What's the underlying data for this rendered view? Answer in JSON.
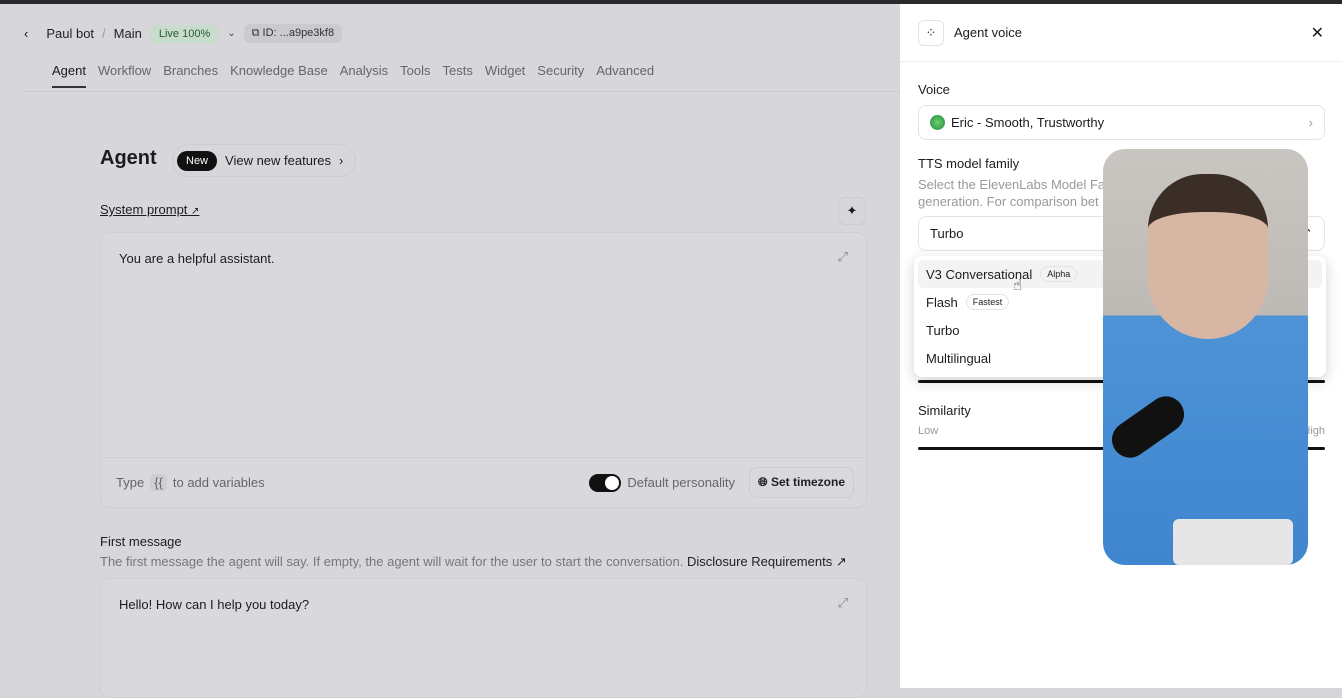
{
  "header": {
    "breadcrumb": [
      "Paul bot",
      "Main"
    ],
    "live_badge": "Live 100%",
    "id_chip": "ID: ...a9pe3kf8"
  },
  "tabs": [
    "Agent",
    "Workflow",
    "Branches",
    "Knowledge Base",
    "Analysis",
    "Tools",
    "Tests",
    "Widget",
    "Security",
    "Advanced"
  ],
  "page": {
    "title": "Agent",
    "new_badge": "New",
    "new_features": "View new features"
  },
  "system_prompt": {
    "label": "System prompt",
    "value": "You are a helpful assistant.",
    "hint_prefix": "Type",
    "hint_var": "{{",
    "hint_suffix": "to add variables",
    "toggle_label": "Default personality",
    "toggle_on": true,
    "timezone_button": "Set timezone"
  },
  "first_message": {
    "label": "First message",
    "description": "The first message the agent will say. If empty, the agent will wait for the user to start the conversation.",
    "link": "Disclosure Requirements",
    "value": "Hello! How can I help you today?"
  },
  "panel": {
    "title": "Agent voice",
    "voice_label": "Voice",
    "voice_value": "Eric - Smooth, Trustworthy",
    "tts_label": "TTS model family",
    "tts_desc1": "Select the ElevenLabs Model Fa",
    "tts_desc2": "generation. For comparison bet",
    "tts_value": "Turbo",
    "options": [
      {
        "label": "V3 Conversational",
        "tag": "Alpha"
      },
      {
        "label": "Flash",
        "tag": "Fastest"
      },
      {
        "label": "Turbo",
        "tag": ""
      },
      {
        "label": "Multilingual",
        "tag": ""
      }
    ],
    "similarity_label": "Similarity",
    "similarity_low": "Low",
    "similarity_high": "High"
  }
}
